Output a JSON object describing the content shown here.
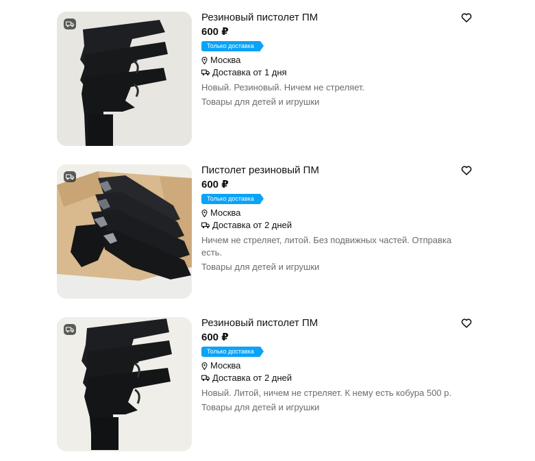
{
  "listings": [
    {
      "title": "Резиновый пистолет ПМ",
      "price": "600 ₽",
      "badge": "Только доставка",
      "location": "Москва",
      "delivery": "Доставка от 1 дня",
      "description": "Новый. Резиновый. Ничем не стреляет.",
      "category": "Товары для детей и игрушки",
      "icons": {
        "image_tag": "truck-icon",
        "location": "map-pin-icon",
        "delivery": "truck-icon",
        "favorite": "heart-icon"
      }
    },
    {
      "title": "Пистолет резиновый ПМ",
      "price": "600 ₽",
      "badge": "Только доставка",
      "location": "Москва",
      "delivery": "Доставка от 2 дней",
      "description": "Ничем не стреляет, литой. Без подвижных частей. Отправка есть.",
      "category": "Товары для детей и игрушки",
      "icons": {
        "image_tag": "truck-icon",
        "location": "map-pin-icon",
        "delivery": "truck-icon",
        "favorite": "heart-icon"
      }
    },
    {
      "title": "Резиновый пистолет ПМ",
      "price": "600 ₽",
      "badge": "Только доставка",
      "location": "Москва",
      "delivery": "Доставка от 2 дней",
      "description": "Новый. Литой, ничем не стреляет. К нему есть кобура 500 р.",
      "category": "Товары для детей и игрушки",
      "icons": {
        "image_tag": "truck-icon",
        "location": "map-pin-icon",
        "delivery": "truck-icon",
        "favorite": "heart-icon"
      }
    }
  ],
  "colors": {
    "badge": "#0aa3f7",
    "text": "#111111",
    "muted": "#6b6b6b"
  }
}
